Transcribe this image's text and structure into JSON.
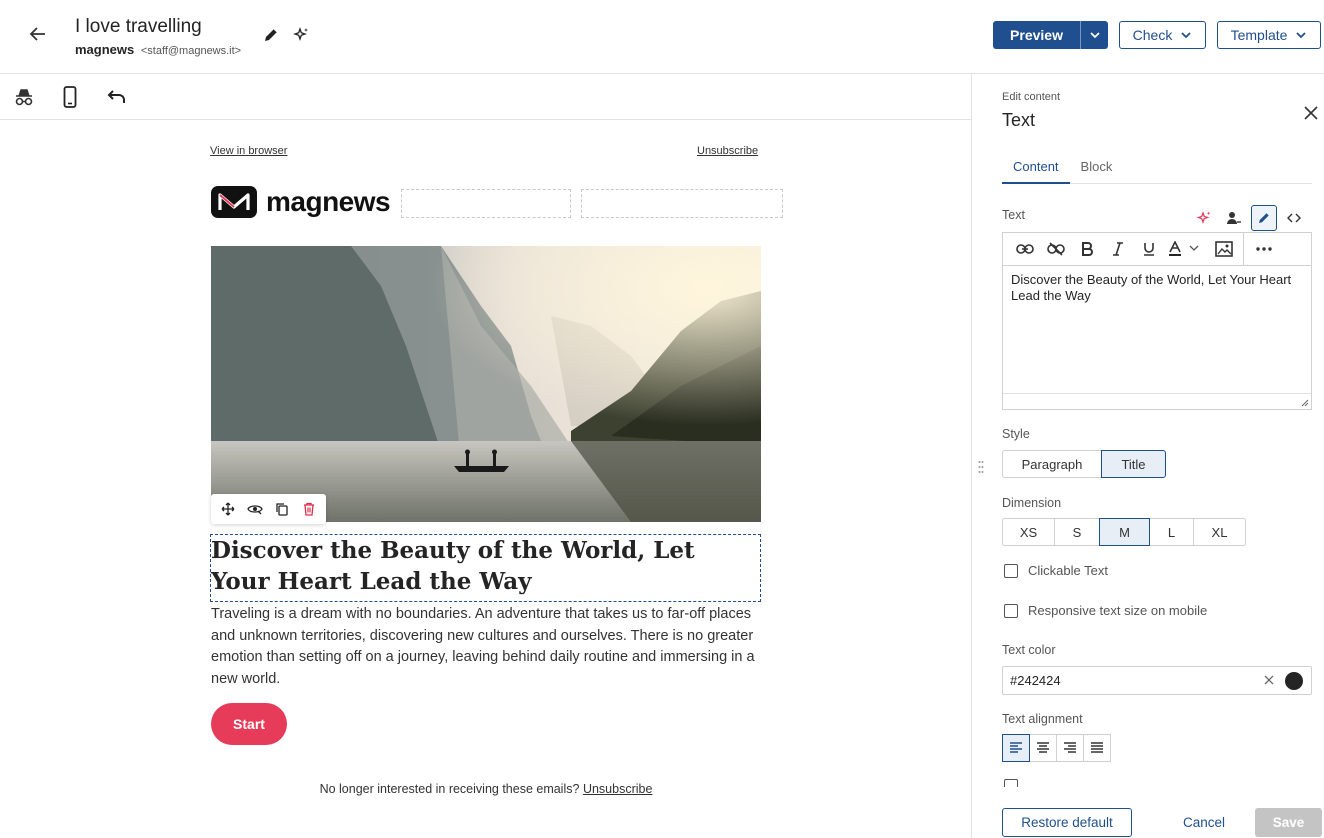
{
  "header": {
    "title": "I love travelling",
    "sender_name": "magnews",
    "sender_email": "<staff@magnews.it>",
    "preview_label": "Preview",
    "check_label": "Check",
    "template_label": "Template"
  },
  "toolbar": {
    "icons": [
      "incognito-icon",
      "mobile-icon",
      "undo-icon"
    ]
  },
  "email": {
    "view_in_browser": "View in browser",
    "unsubscribe_top": "Unsubscribe",
    "logo_text": "magnews",
    "headline": "Discover the Beauty of the World, Let Your Heart Lead the Way",
    "body": "Traveling is a dream with no boundaries. An adventure that takes us to far-off places and unknown territories, discovering new cultures and ourselves. There is no greater emotion than setting off on a journey, leaving behind daily routine and immersing in a new world.",
    "cta_label": "Start",
    "footer_text": "No longer interested in receiving these emails?",
    "footer_link": "Unsubscribe"
  },
  "panel": {
    "subtitle": "Edit content",
    "title": "Text",
    "tabs": [
      {
        "label": "Content",
        "active": true
      },
      {
        "label": "Block",
        "active": false
      }
    ],
    "text_label": "Text",
    "editor_content": "Discover the Beauty of the World, Let Your Heart Lead the Way",
    "style_label": "Style",
    "style_options": [
      "Paragraph",
      "Title"
    ],
    "style_selected": "Title",
    "dimension_label": "Dimension",
    "dimension_options": [
      "XS",
      "S",
      "M",
      "L",
      "XL"
    ],
    "dimension_selected": "M",
    "clickable_text_label": "Clickable Text",
    "responsive_label": "Responsive text size on mobile",
    "text_color_label": "Text color",
    "text_color_value": "#242424",
    "text_alignment_label": "Text alignment",
    "restore_label": "Restore default",
    "cancel_label": "Cancel",
    "save_label": "Save"
  },
  "colors": {
    "brand_blue": "#1f4f8f",
    "cta_red": "#e63c5a",
    "text": "#242424"
  }
}
